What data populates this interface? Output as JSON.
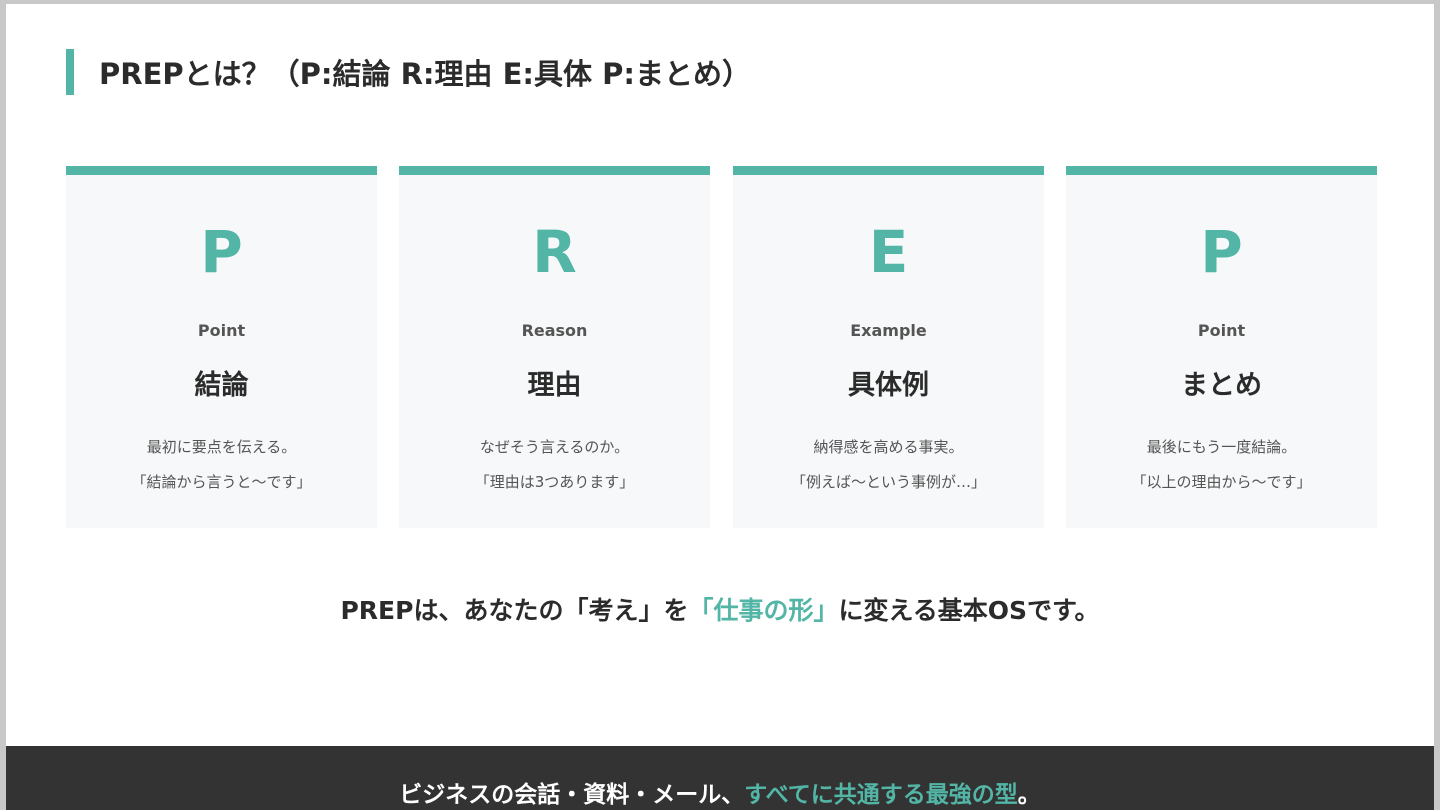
{
  "header": {
    "title": "PREPとは？（P:結論 R:理由 E:具体 P:まとめ）"
  },
  "cards": [
    {
      "letter": "P",
      "english": "Point",
      "japanese": "結論",
      "description_line1": "最初に要点を伝える。",
      "description_line2": "「結論から言うと〜です」"
    },
    {
      "letter": "R",
      "english": "Reason",
      "japanese": "理由",
      "description_line1": "なぜそう言えるのか。",
      "description_line2": "「理由は3つあります」"
    },
    {
      "letter": "E",
      "english": "Example",
      "japanese": "具体例",
      "description_line1": "納得感を高める事実。",
      "description_line2": "「例えば〜という事例が…」"
    },
    {
      "letter": "P",
      "english": "Point",
      "japanese": "まとめ",
      "description_line1": "最後にもう一度結論。",
      "description_line2": "「以上の理由から〜です」"
    }
  ],
  "summary": {
    "prefix": "PREPは、あなたの「考え」を",
    "highlight": "「仕事の形」",
    "suffix": "に変える基本OSです。"
  },
  "footer": {
    "prefix": "ビジネスの会話・資料・メール、",
    "highlight": "すべてに共通する最強の型",
    "suffix": "。"
  },
  "colors": {
    "accent": "#52b5a5",
    "card_background": "#f6f8f9",
    "text_dark": "#2b2b2b",
    "text_muted": "#555555",
    "footer_background": "#333333"
  }
}
